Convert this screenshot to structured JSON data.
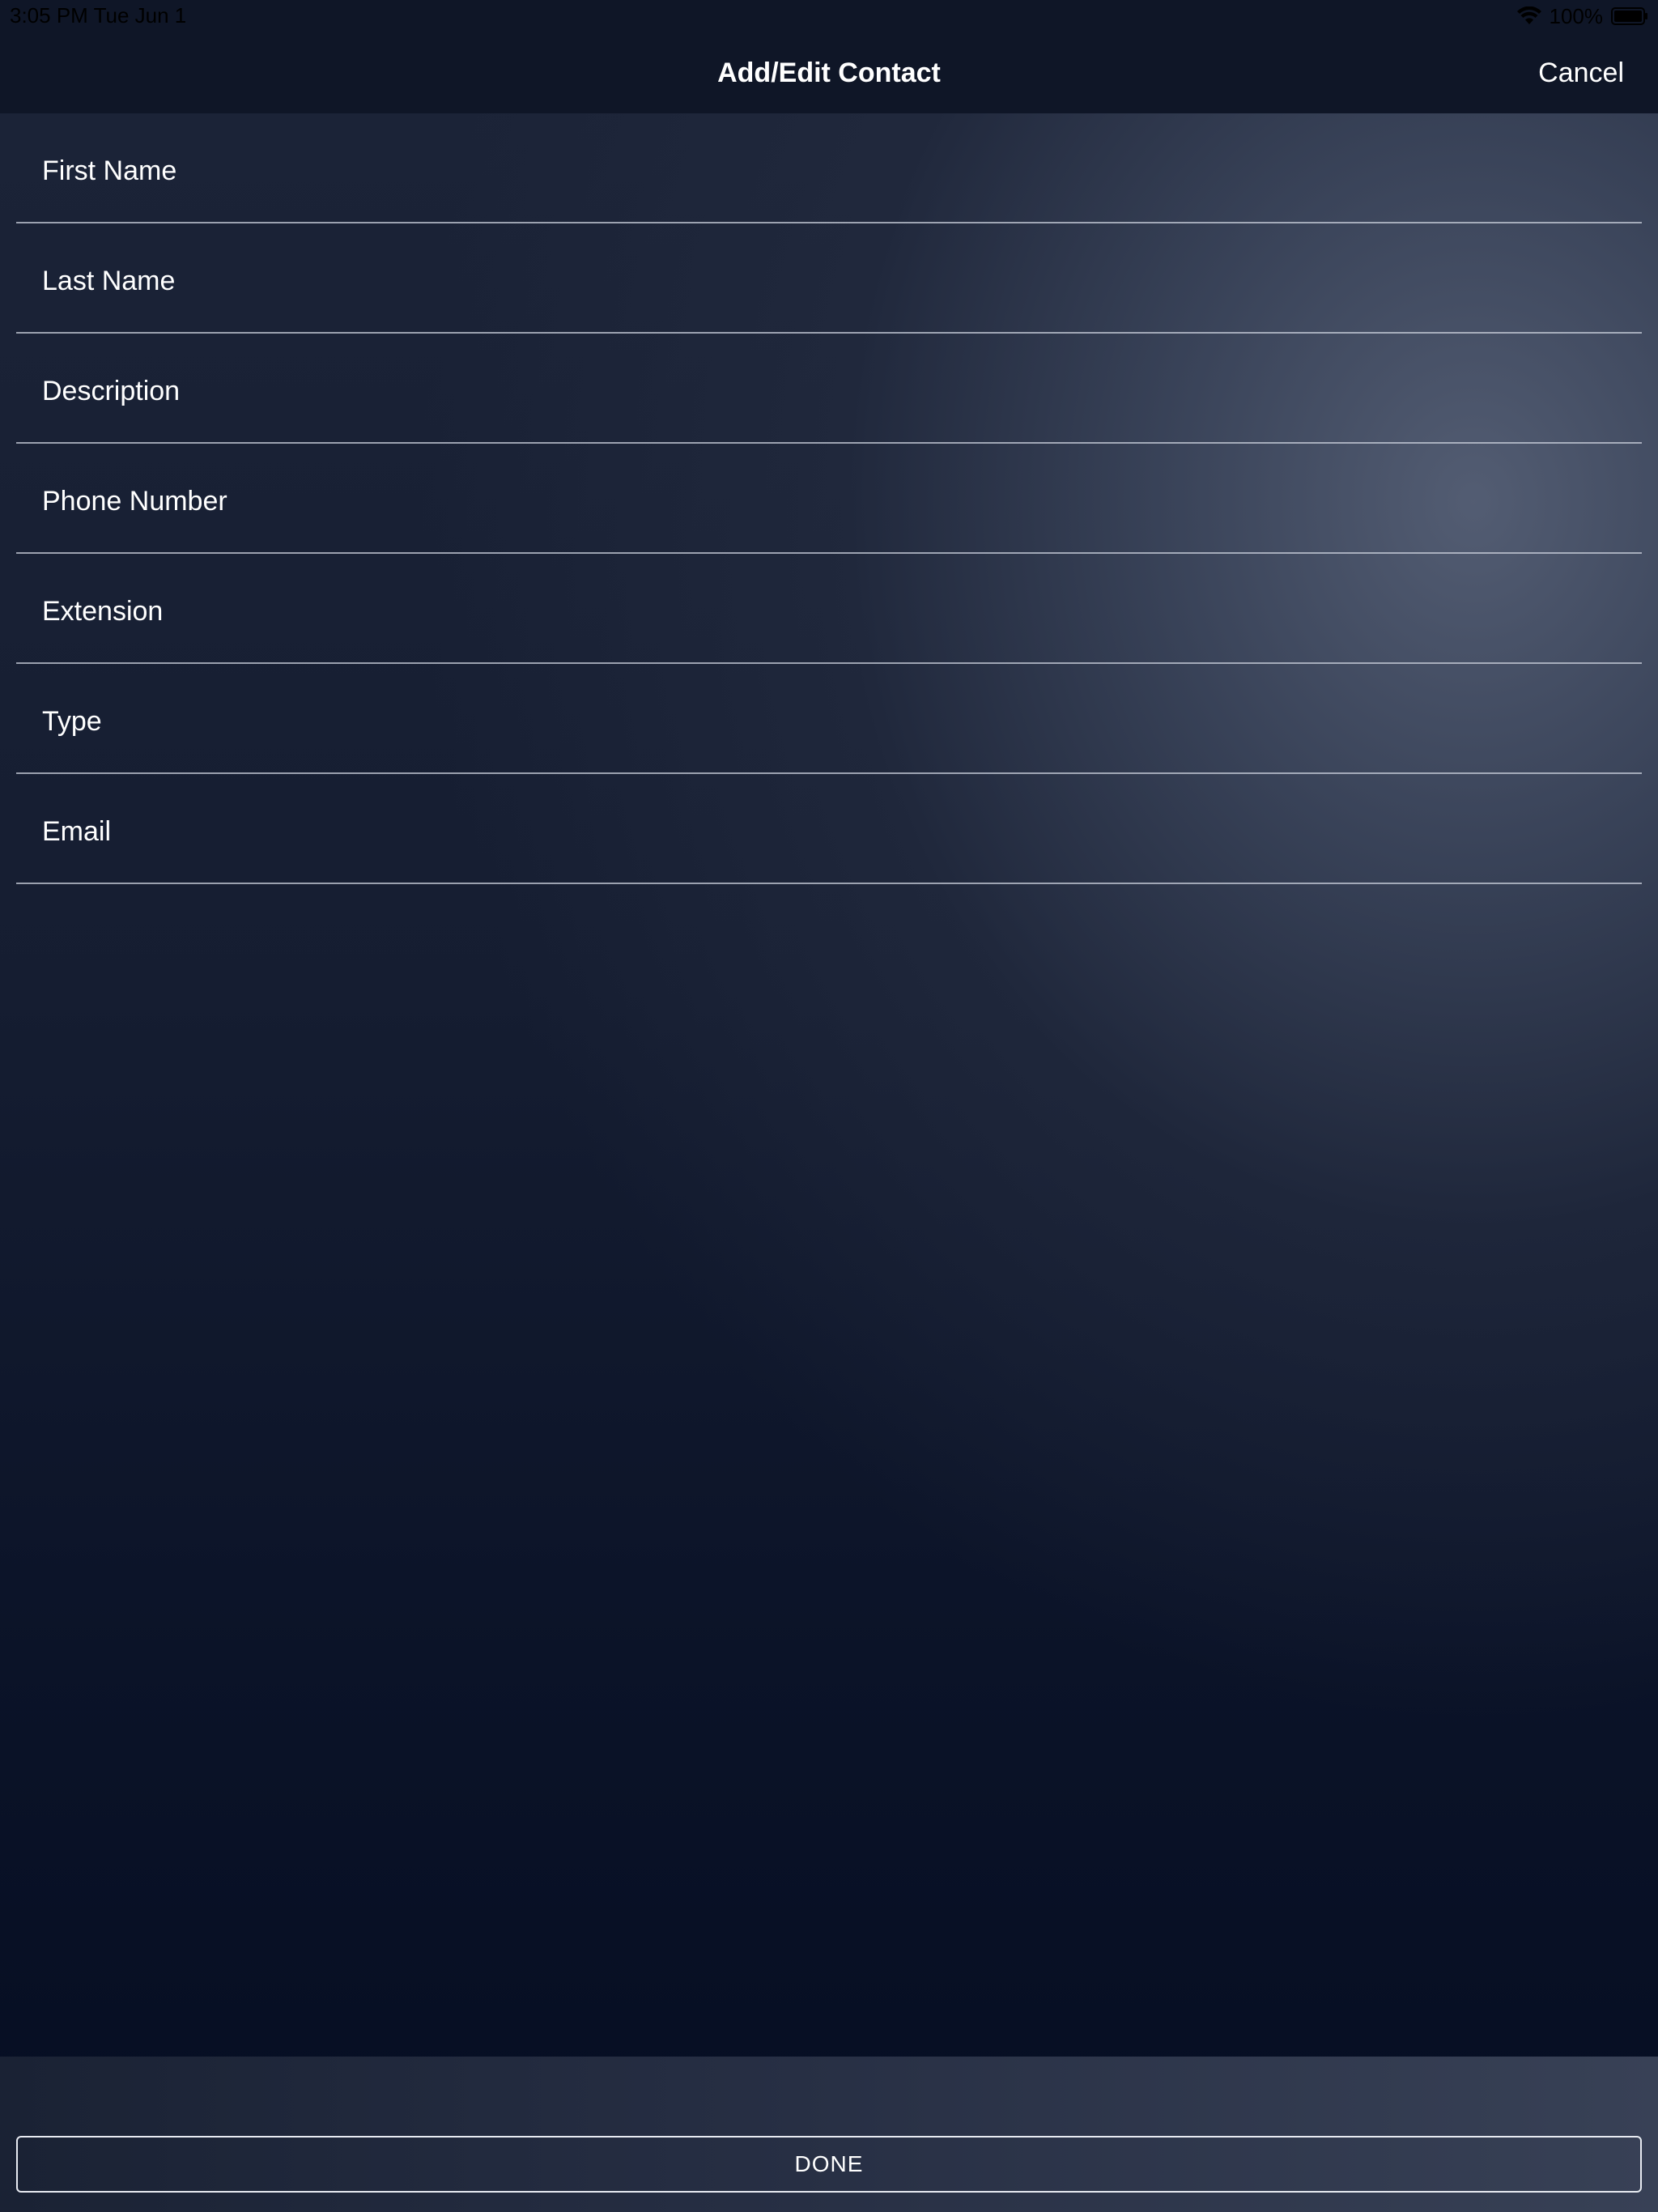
{
  "status_bar": {
    "time": "3:05 PM   Tue Jun 1",
    "battery": "100%",
    "icons": [
      "wifi-icon",
      "battery-icon"
    ]
  },
  "nav": {
    "title": "Add/Edit Contact",
    "cancel_label": "Cancel"
  },
  "form": {
    "fields": [
      {
        "placeholder": "First Name",
        "value": ""
      },
      {
        "placeholder": "Last Name",
        "value": ""
      },
      {
        "placeholder": "Description",
        "value": ""
      },
      {
        "placeholder": "Phone Number",
        "value": ""
      },
      {
        "placeholder": "Extension",
        "value": ""
      },
      {
        "placeholder": "Type",
        "value": ""
      },
      {
        "placeholder": "Email",
        "value": ""
      }
    ]
  },
  "footer": {
    "done_label": "DONE"
  },
  "colors": {
    "nav_background": "#0f1627",
    "text": "#ffffff",
    "divider": "#c8ceda"
  }
}
